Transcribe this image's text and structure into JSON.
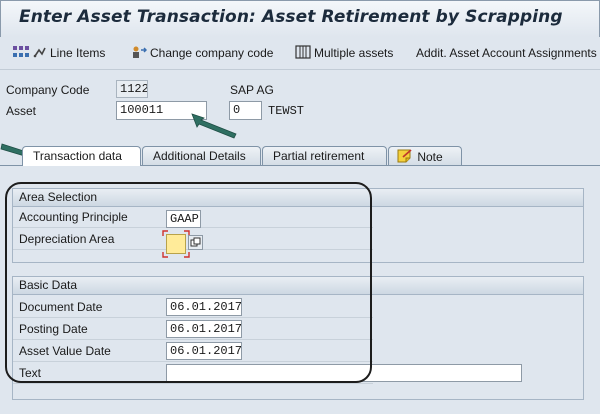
{
  "window": {
    "title": "Enter Asset Transaction: Asset Retirement by Scrapping"
  },
  "toolbar": {
    "line_items": "Line Items",
    "change_company_code": "Change company code",
    "multiple_assets": "Multiple assets",
    "addit_assignments": "Addit. Asset Account Assignments"
  },
  "header": {
    "company_code_label": "Company Code",
    "company_code_value": "1122",
    "company_name": "SAP AG",
    "asset_label": "Asset",
    "asset_value": "100011",
    "sub_number": "0",
    "asset_description": "TEWST"
  },
  "tabs": [
    {
      "label": "Transaction data",
      "active": true
    },
    {
      "label": "Additional Details",
      "active": false
    },
    {
      "label": "Partial retirement",
      "active": false
    },
    {
      "label": "Note",
      "active": false
    }
  ],
  "area_selection": {
    "title": "Area Selection",
    "accounting_principle_label": "Accounting Principle",
    "accounting_principle_value": "GAAP",
    "depreciation_area_label": "Depreciation Area",
    "depreciation_area_value": ""
  },
  "basic_data": {
    "title": "Basic Data",
    "document_date_label": "Document Date",
    "document_date_value": "06.01.2017",
    "posting_date_label": "Posting Date",
    "posting_date_value": "06.01.2017",
    "asset_value_date_label": "Asset Value Date",
    "asset_value_date_value": "06.01.2017",
    "text_label": "Text",
    "text_value": ""
  },
  "colors": {
    "highlight": "#1d1d1d",
    "arrow": "#2f6f62",
    "required_field": "#ffeb99",
    "required_marker": "#d0312d"
  }
}
